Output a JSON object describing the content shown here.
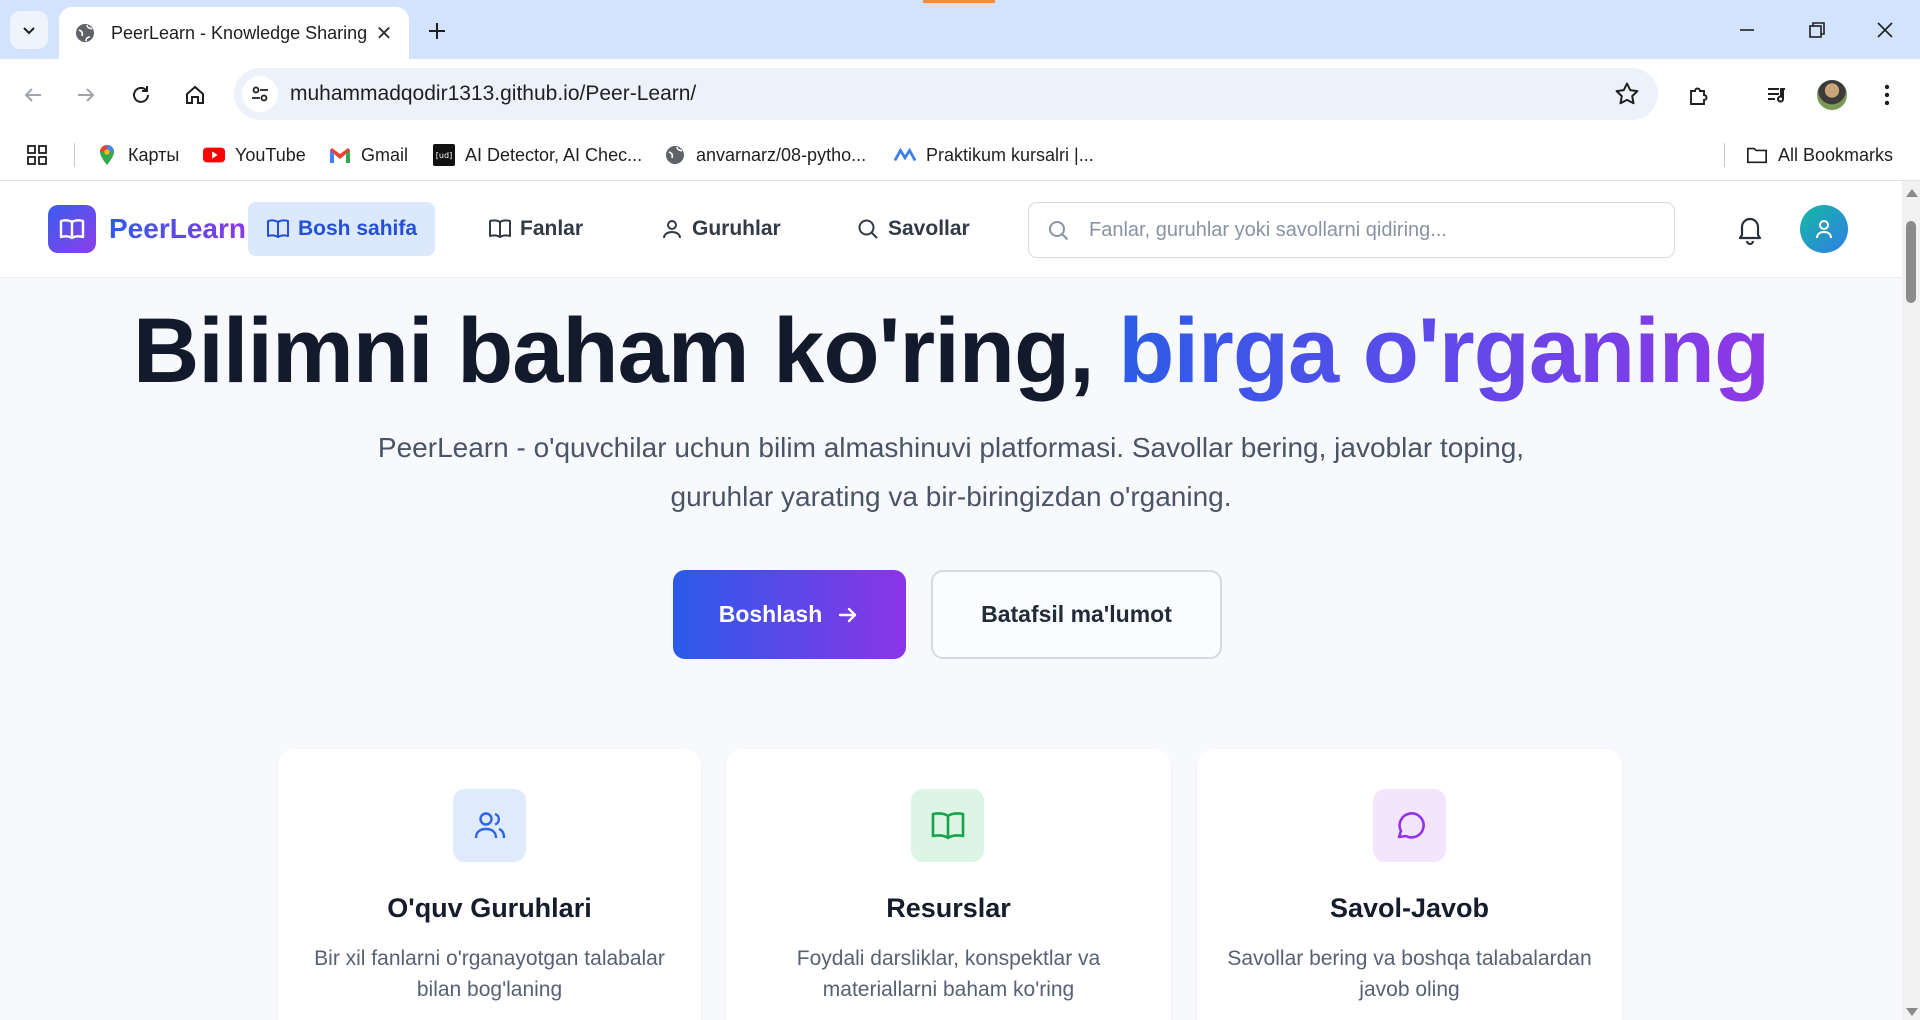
{
  "browser": {
    "tab_title": "PeerLearn - Knowledge Sharing",
    "url": "muhammadqodir1313.github.io/Peer-Learn/",
    "bookmarks": [
      {
        "label": "Карты",
        "icon": "maps-pin-icon"
      },
      {
        "label": "YouTube",
        "icon": "youtube-icon"
      },
      {
        "label": "Gmail",
        "icon": "gmail-icon"
      },
      {
        "label": "AI Detector, AI Chec...",
        "icon": "ud-icon"
      },
      {
        "label": "anvarnarz/08-pytho...",
        "icon": "globe-icon"
      },
      {
        "label": "Praktikum kursalri |...",
        "icon": "praktikum-icon"
      }
    ],
    "all_bookmarks": "All Bookmarks"
  },
  "header": {
    "logo_text": "PeerLearn",
    "nav": [
      {
        "label": "Bosh sahifa",
        "icon": "book-open-icon",
        "active": true
      },
      {
        "label": "Fanlar",
        "icon": "book-open-icon",
        "active": false
      },
      {
        "label": "Guruhlar",
        "icon": "user-icon",
        "active": false
      },
      {
        "label": "Savollar",
        "icon": "search-icon",
        "active": false
      }
    ],
    "search_placeholder": "Fanlar, guruhlar yoki savollarni qidiring..."
  },
  "hero": {
    "title_plain": "Bilimni baham ko'ring, ",
    "title_highlight": "birga o'rganing",
    "subtitle": "PeerLearn - o'quvchilar uchun bilim almashinuvi platformasi. Savollar bering, javoblar toping, guruhlar yarating va bir-biringizdan o'rganing.",
    "primary_button": "Boshlash",
    "secondary_button": "Batafsil ma'lumot"
  },
  "features": [
    {
      "title": "O'quv Guruhlari",
      "text": "Bir xil fanlarni o'rganayotgan talabalar bilan bog'laning",
      "icon": "users-icon",
      "color": "#2f64e6",
      "bg": "#dfeafc"
    },
    {
      "title": "Resurslar",
      "text": "Foydali darsliklar, konspektlar va materiallarni baham ko'ring",
      "icon": "book-open-icon",
      "color": "#17a34a",
      "bg": "#dcf5e5"
    },
    {
      "title": "Savol-Javob",
      "text": "Savollar bering va boshqa talabalardan javob oling",
      "icon": "message-circle-icon",
      "color": "#9333ea",
      "bg": "#f3e6fc"
    }
  ],
  "colors": {
    "brand_blue": "#2c5de6",
    "brand_purple": "#8f38e6",
    "page_bg": "#f7f9fc",
    "chrome_tabbar": "#d3e3fd"
  }
}
